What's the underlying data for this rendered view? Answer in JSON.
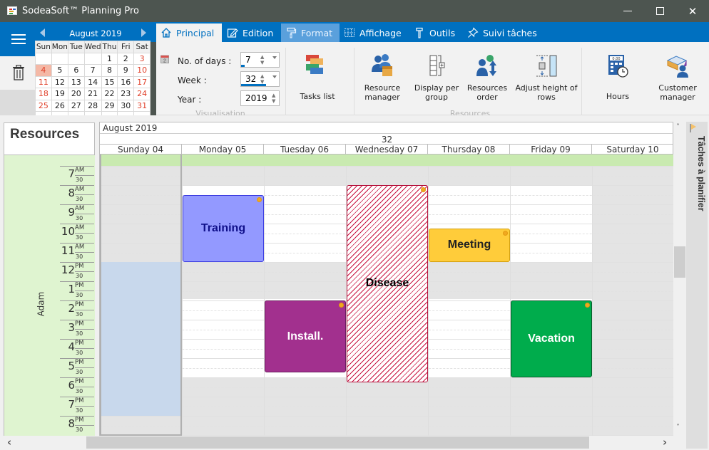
{
  "window": {
    "title": "SodeaSoft™ Planning Pro",
    "minimize_glyph": "—",
    "maximize_glyph": "□",
    "close_glyph": "✕"
  },
  "mini_calendar": {
    "month_label": "August 2019",
    "day_headers": [
      "Sun",
      "Mon",
      "Tue",
      "Wed",
      "Thu",
      "Fri",
      "Sat"
    ],
    "weeks": [
      [
        "",
        "",
        "",
        "",
        "1",
        "2",
        "3"
      ],
      [
        "4",
        "5",
        "6",
        "7",
        "8",
        "9",
        "10"
      ],
      [
        "11",
        "12",
        "13",
        "14",
        "15",
        "16",
        "17"
      ],
      [
        "18",
        "19",
        "20",
        "21",
        "22",
        "23",
        "24"
      ],
      [
        "25",
        "26",
        "27",
        "28",
        "29",
        "30",
        "31"
      ]
    ],
    "today": "4"
  },
  "tabs": [
    {
      "label": "Principal",
      "icon": "home-icon"
    },
    {
      "label": "Edition",
      "icon": "pencil-icon"
    },
    {
      "label": "Format",
      "icon": "paint-roller-icon"
    },
    {
      "label": "Affichage",
      "icon": "grid-icon"
    },
    {
      "label": "Outils",
      "icon": "hammer-icon"
    },
    {
      "label": "Suivi tâches",
      "icon": "pin-icon"
    }
  ],
  "visualisation": {
    "group_label": "Visualisation",
    "no_days_label": "No. of days :",
    "no_days_value": "7",
    "no_days_progress": 0.05,
    "week_label": "Week :",
    "week_value": "32",
    "week_progress": 0.6,
    "year_label": "Year :",
    "year_value": "2019"
  },
  "ribbon_buttons": {
    "tasks_list": "Tasks list",
    "resource_manager_1": "Resource",
    "resource_manager_2": "manager",
    "display_group_1": "Display per",
    "display_group_2": "group",
    "resources_order_1": "Resources",
    "resources_order_2": "order",
    "adjust_height_1": "Adjust height of",
    "adjust_height_2": "rows",
    "resources_group_label": "Resources",
    "hours": "Hours",
    "customer_manager_1": "Customer",
    "customer_manager_2": "manager"
  },
  "planner": {
    "resources_title": "Resources",
    "resource_name": "Adam",
    "month_label": "August 2019",
    "week_number": "32",
    "days": [
      "Sunday 04",
      "Monday 05",
      "Tuesday 06",
      "Wednesday 07",
      "Thursday 08",
      "Friday 09",
      "Saturday 10"
    ],
    "hours": [
      {
        "h": "7",
        "p": "AM"
      },
      {
        "h": "8",
        "p": "AM"
      },
      {
        "h": "9",
        "p": "AM"
      },
      {
        "h": "10",
        "p": "AM"
      },
      {
        "h": "11",
        "p": "AM"
      },
      {
        "h": "12",
        "p": "PM"
      },
      {
        "h": "1",
        "p": "PM"
      },
      {
        "h": "2",
        "p": "PM"
      },
      {
        "h": "3",
        "p": "PM"
      },
      {
        "h": "4",
        "p": "PM"
      },
      {
        "h": "5",
        "p": "PM"
      },
      {
        "h": "6",
        "p": "PM"
      },
      {
        "h": "7",
        "p": "PM"
      },
      {
        "h": "8",
        "p": "PM"
      }
    ],
    "half_label": "30",
    "events": [
      {
        "title": "Training",
        "day": 1,
        "start": "8:30",
        "end": "12:00",
        "bg": "#9399ff",
        "border": "#3a3adf",
        "color": "#10108a"
      },
      {
        "title": "Install.",
        "day": 2,
        "start": "14:00",
        "end": "17:45",
        "bg": "#a2308e",
        "border": "#6b1d5e",
        "color": "#ffffff"
      },
      {
        "title": "Disease",
        "day": 3,
        "start": "8:00",
        "end": "18:15",
        "bg": "hatch",
        "border": "#b4103a",
        "color": "#000000"
      },
      {
        "title": "Meeting",
        "day": 4,
        "start": "10:15",
        "end": "12:00",
        "bg": "#ffcc3a",
        "border": "#d4a010",
        "color": "#222222"
      },
      {
        "title": "Vacation",
        "day": 5,
        "start": "14:00",
        "end": "18:00",
        "bg": "#00ac4c",
        "border": "#0a5a2a",
        "color": "#ffffff"
      }
    ]
  },
  "side_panel": {
    "label": "Tâches à planifier"
  },
  "scroll": {
    "up": "˄",
    "down": "˅",
    "left": "‹",
    "right": "›"
  }
}
